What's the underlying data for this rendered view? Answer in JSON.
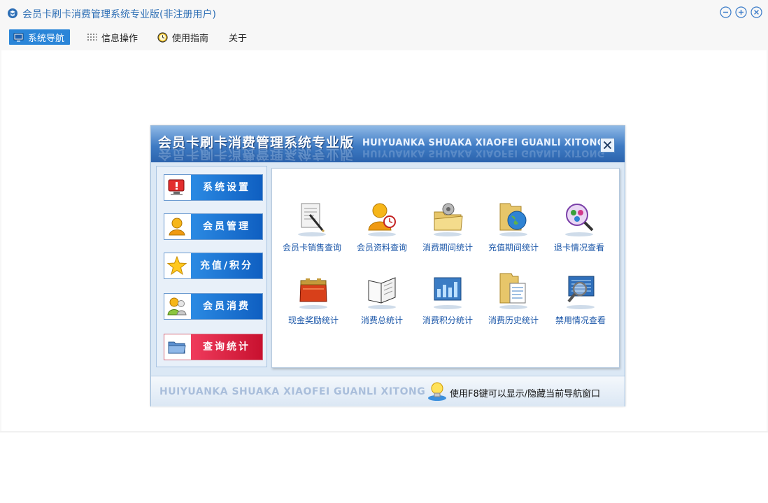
{
  "window": {
    "title": "会员卡刷卡消费管理系统专业版(非注册用户)",
    "icons": [
      "app-icon",
      "minimize-icon",
      "restore-icon",
      "close-icon"
    ]
  },
  "menu": [
    {
      "label": "系统导航",
      "icon": "monitor-icon",
      "active": true
    },
    {
      "label": "信息操作",
      "icon": "grid-icon",
      "active": false
    },
    {
      "label": "使用指南",
      "icon": "clock-icon",
      "active": false
    },
    {
      "label": "关于",
      "icon": "",
      "active": false
    }
  ],
  "nav": {
    "title": "会员卡刷卡消费管理系统专业版",
    "subtitle": "HUIYUANKA SHUAKA XIAOFEI GUANLI XITONG",
    "side_buttons": [
      {
        "label": "系统设置",
        "icon": "settings-alert-icon",
        "color": "#1a6fd0"
      },
      {
        "label": "会员管理",
        "icon": "user-icon",
        "color": "#1a6fd0"
      },
      {
        "label": "充值/积分",
        "icon": "star-icon",
        "color": "#1a6fd0"
      },
      {
        "label": "会员消费",
        "icon": "users-icon",
        "color": "#1a6fd0"
      },
      {
        "label": "查询统计",
        "icon": "folder-icon",
        "color": "#e0203f"
      }
    ],
    "tiles": [
      {
        "label": "会员卡销售查询",
        "icon": "document-pen-icon"
      },
      {
        "label": "会员资料查询",
        "icon": "user-clock-icon"
      },
      {
        "label": "消费期间统计",
        "icon": "folder-gear-icon"
      },
      {
        "label": "充值期间统计",
        "icon": "folder-globe-icon"
      },
      {
        "label": "退卡情况查看",
        "icon": "magnifier-people-icon"
      },
      {
        "label": "现金奖励统计",
        "icon": "purse-icon"
      },
      {
        "label": "消费总统计",
        "icon": "notebook-icon"
      },
      {
        "label": "消费积分统计",
        "icon": "chart-board-icon"
      },
      {
        "label": "消费历史统计",
        "icon": "folder-docs-icon"
      },
      {
        "label": "禁用情况查看",
        "icon": "magnifier-screen-icon"
      }
    ],
    "footer_text": "HUIYUANKA SHUAKA XIAOFEI GUANLI XITONG",
    "footer_tip": "使用F8键可以显示/隐藏当前导航窗口"
  }
}
